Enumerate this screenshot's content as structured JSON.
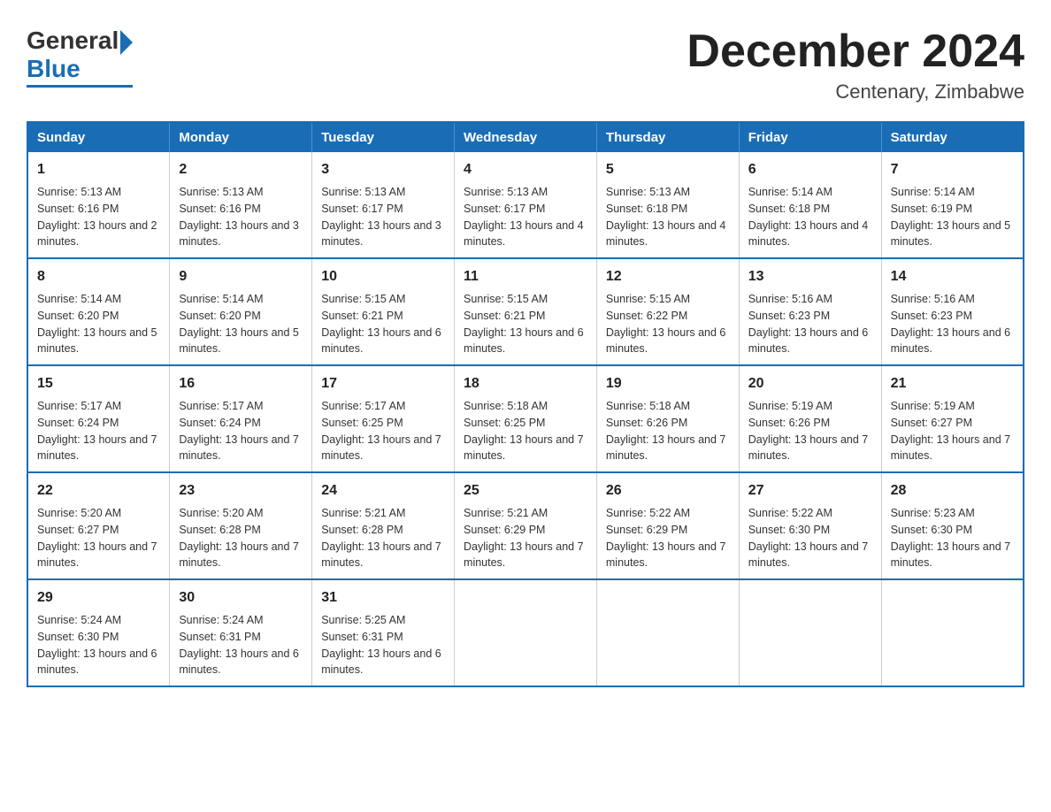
{
  "logo": {
    "general": "General",
    "blue": "Blue"
  },
  "header": {
    "month": "December 2024",
    "location": "Centenary, Zimbabwe"
  },
  "days_of_week": [
    "Sunday",
    "Monday",
    "Tuesday",
    "Wednesday",
    "Thursday",
    "Friday",
    "Saturday"
  ],
  "weeks": [
    [
      {
        "day": "1",
        "sunrise": "5:13 AM",
        "sunset": "6:16 PM",
        "daylight": "13 hours and 2 minutes."
      },
      {
        "day": "2",
        "sunrise": "5:13 AM",
        "sunset": "6:16 PM",
        "daylight": "13 hours and 3 minutes."
      },
      {
        "day": "3",
        "sunrise": "5:13 AM",
        "sunset": "6:17 PM",
        "daylight": "13 hours and 3 minutes."
      },
      {
        "day": "4",
        "sunrise": "5:13 AM",
        "sunset": "6:17 PM",
        "daylight": "13 hours and 4 minutes."
      },
      {
        "day": "5",
        "sunrise": "5:13 AM",
        "sunset": "6:18 PM",
        "daylight": "13 hours and 4 minutes."
      },
      {
        "day": "6",
        "sunrise": "5:14 AM",
        "sunset": "6:18 PM",
        "daylight": "13 hours and 4 minutes."
      },
      {
        "day": "7",
        "sunrise": "5:14 AM",
        "sunset": "6:19 PM",
        "daylight": "13 hours and 5 minutes."
      }
    ],
    [
      {
        "day": "8",
        "sunrise": "5:14 AM",
        "sunset": "6:20 PM",
        "daylight": "13 hours and 5 minutes."
      },
      {
        "day": "9",
        "sunrise": "5:14 AM",
        "sunset": "6:20 PM",
        "daylight": "13 hours and 5 minutes."
      },
      {
        "day": "10",
        "sunrise": "5:15 AM",
        "sunset": "6:21 PM",
        "daylight": "13 hours and 6 minutes."
      },
      {
        "day": "11",
        "sunrise": "5:15 AM",
        "sunset": "6:21 PM",
        "daylight": "13 hours and 6 minutes."
      },
      {
        "day": "12",
        "sunrise": "5:15 AM",
        "sunset": "6:22 PM",
        "daylight": "13 hours and 6 minutes."
      },
      {
        "day": "13",
        "sunrise": "5:16 AM",
        "sunset": "6:23 PM",
        "daylight": "13 hours and 6 minutes."
      },
      {
        "day": "14",
        "sunrise": "5:16 AM",
        "sunset": "6:23 PM",
        "daylight": "13 hours and 6 minutes."
      }
    ],
    [
      {
        "day": "15",
        "sunrise": "5:17 AM",
        "sunset": "6:24 PM",
        "daylight": "13 hours and 7 minutes."
      },
      {
        "day": "16",
        "sunrise": "5:17 AM",
        "sunset": "6:24 PM",
        "daylight": "13 hours and 7 minutes."
      },
      {
        "day": "17",
        "sunrise": "5:17 AM",
        "sunset": "6:25 PM",
        "daylight": "13 hours and 7 minutes."
      },
      {
        "day": "18",
        "sunrise": "5:18 AM",
        "sunset": "6:25 PM",
        "daylight": "13 hours and 7 minutes."
      },
      {
        "day": "19",
        "sunrise": "5:18 AM",
        "sunset": "6:26 PM",
        "daylight": "13 hours and 7 minutes."
      },
      {
        "day": "20",
        "sunrise": "5:19 AM",
        "sunset": "6:26 PM",
        "daylight": "13 hours and 7 minutes."
      },
      {
        "day": "21",
        "sunrise": "5:19 AM",
        "sunset": "6:27 PM",
        "daylight": "13 hours and 7 minutes."
      }
    ],
    [
      {
        "day": "22",
        "sunrise": "5:20 AM",
        "sunset": "6:27 PM",
        "daylight": "13 hours and 7 minutes."
      },
      {
        "day": "23",
        "sunrise": "5:20 AM",
        "sunset": "6:28 PM",
        "daylight": "13 hours and 7 minutes."
      },
      {
        "day": "24",
        "sunrise": "5:21 AM",
        "sunset": "6:28 PM",
        "daylight": "13 hours and 7 minutes."
      },
      {
        "day": "25",
        "sunrise": "5:21 AM",
        "sunset": "6:29 PM",
        "daylight": "13 hours and 7 minutes."
      },
      {
        "day": "26",
        "sunrise": "5:22 AM",
        "sunset": "6:29 PM",
        "daylight": "13 hours and 7 minutes."
      },
      {
        "day": "27",
        "sunrise": "5:22 AM",
        "sunset": "6:30 PM",
        "daylight": "13 hours and 7 minutes."
      },
      {
        "day": "28",
        "sunrise": "5:23 AM",
        "sunset": "6:30 PM",
        "daylight": "13 hours and 7 minutes."
      }
    ],
    [
      {
        "day": "29",
        "sunrise": "5:24 AM",
        "sunset": "6:30 PM",
        "daylight": "13 hours and 6 minutes."
      },
      {
        "day": "30",
        "sunrise": "5:24 AM",
        "sunset": "6:31 PM",
        "daylight": "13 hours and 6 minutes."
      },
      {
        "day": "31",
        "sunrise": "5:25 AM",
        "sunset": "6:31 PM",
        "daylight": "13 hours and 6 minutes."
      },
      null,
      null,
      null,
      null
    ]
  ]
}
